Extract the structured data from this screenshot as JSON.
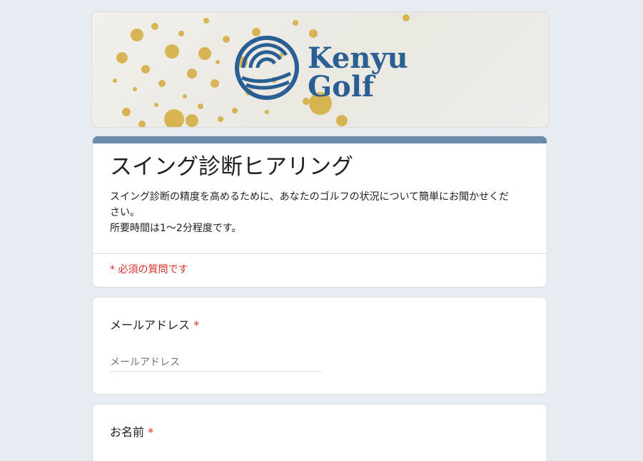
{
  "banner": {
    "logo_line1": "Kenyu",
    "logo_line2": "Golf",
    "brand_color": "#2a5f93",
    "accent_gold": "#d4ab3a"
  },
  "form": {
    "title": "スイング診断ヒアリング",
    "description_line1": "スイング診断の精度を高めるために、あなたのゴルフの状況について簡単にお聞かせくだ",
    "description_line2": "さい。",
    "description_line3": "所要時間は1〜2分程度です。",
    "required_note": "* 必須の質問です",
    "theme_color": "#6a8bac"
  },
  "questions": [
    {
      "label": "メールアドレス",
      "required_mark": "*",
      "placeholder": "メールアドレス"
    },
    {
      "label": "お名前",
      "required_mark": "*"
    }
  ]
}
